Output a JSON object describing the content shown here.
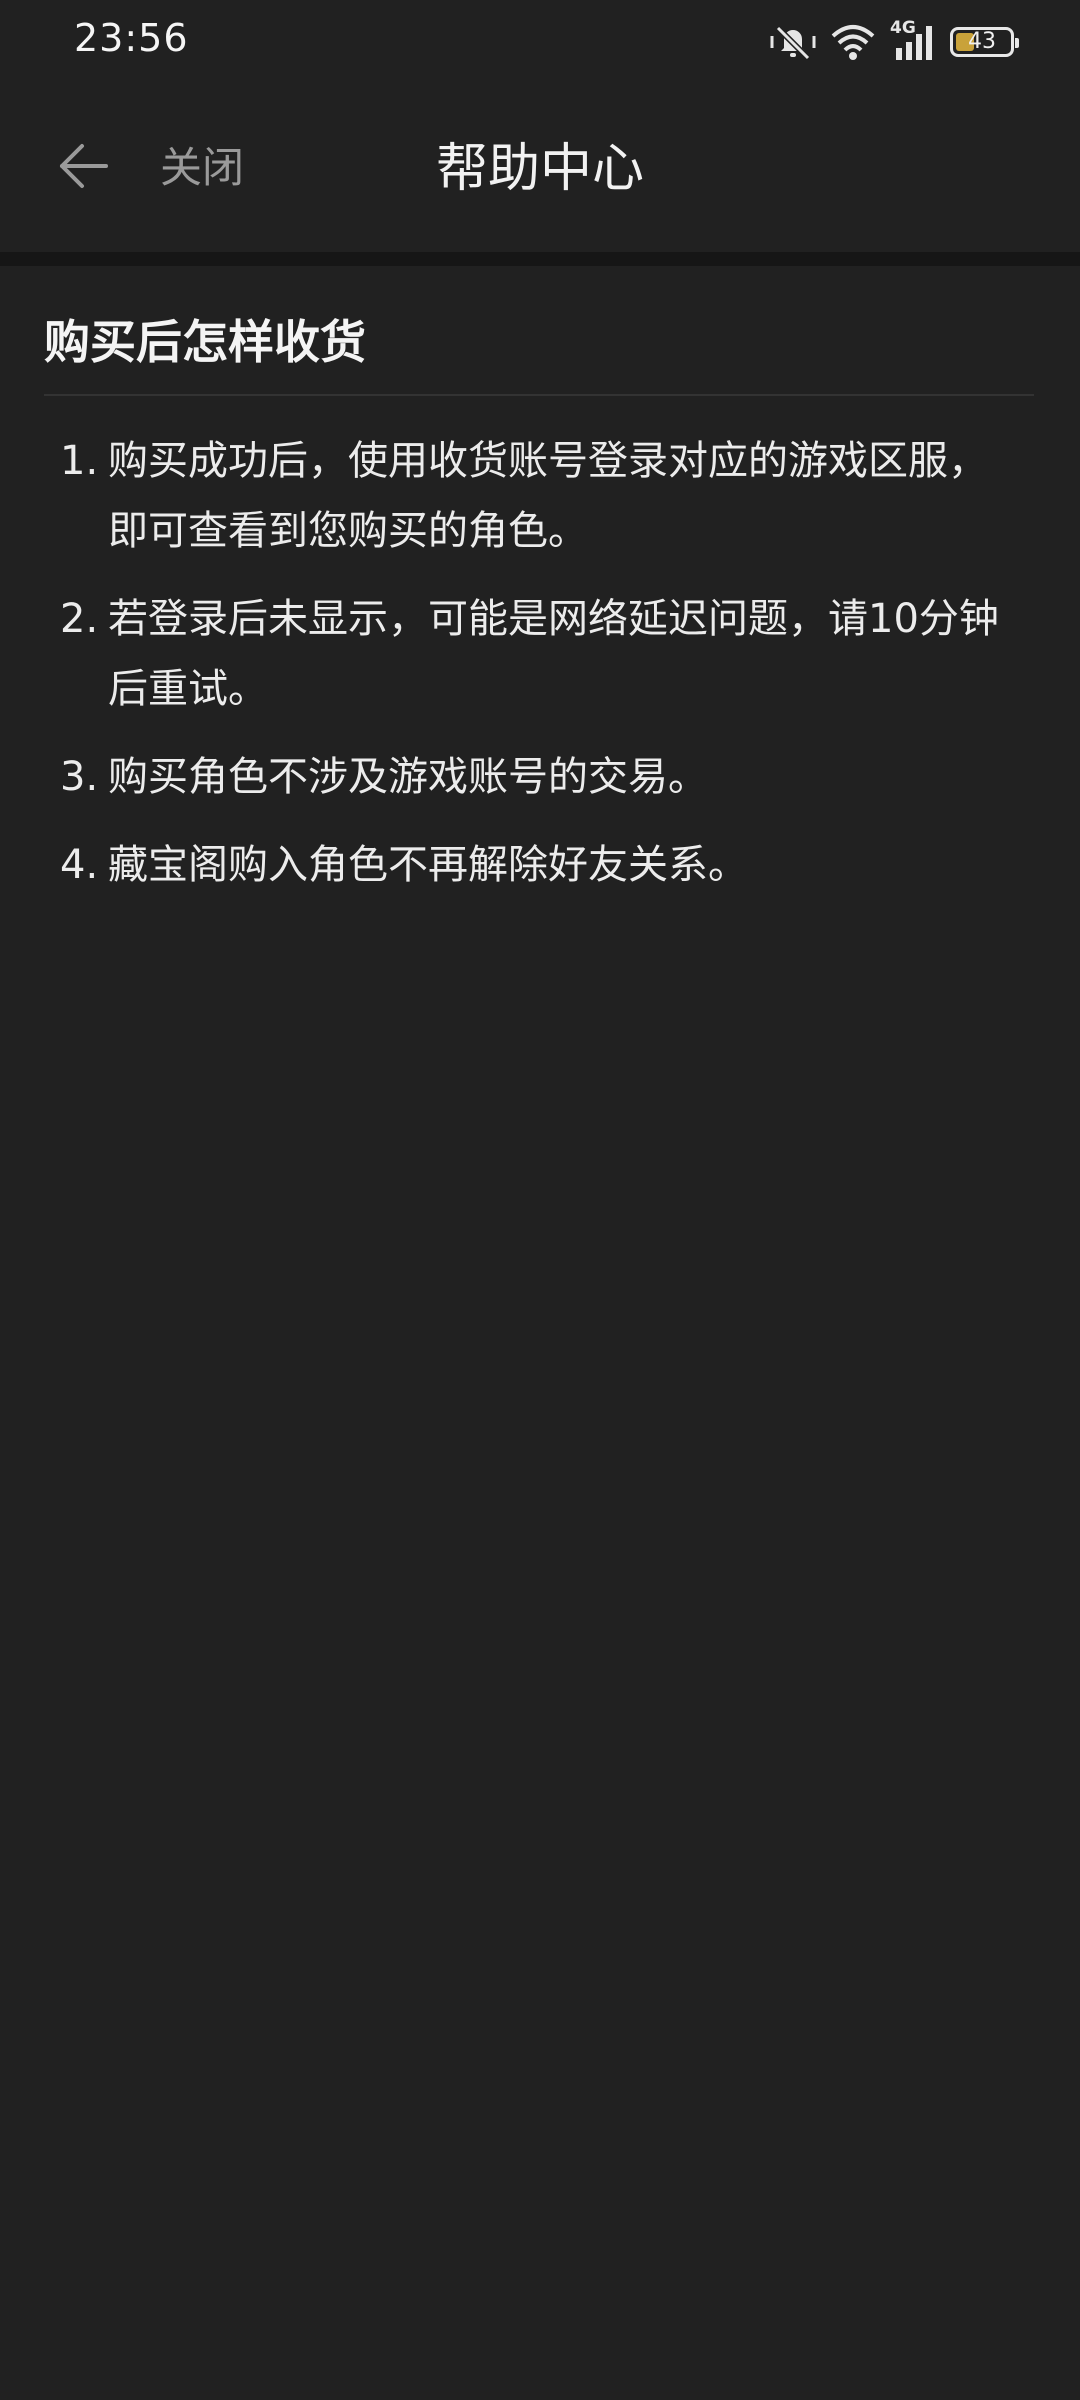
{
  "status_bar": {
    "time": "23:56",
    "network": "4G",
    "battery": "43",
    "icons": [
      "mute-vibrate-icon",
      "wifi-icon",
      "cellular-signal-icon",
      "battery-icon"
    ]
  },
  "nav": {
    "back_icon": "arrow-left-icon",
    "close_label": "关闭",
    "title": "帮助中心"
  },
  "article": {
    "title": "购买后怎样收货",
    "steps": [
      {
        "num": "1.",
        "text": "购买成功后，使用收货账号登录对应的游戏区服，即可查看到您购买的角色。"
      },
      {
        "num": "2.",
        "text": "若登录后未显示，可能是网络延迟问题，请10分钟后重试。"
      },
      {
        "num": "3.",
        "text": "购买角色不涉及游戏账号的交易。"
      },
      {
        "num": "4.",
        "text": "藏宝阁购入角色不再解除好友关系。"
      }
    ]
  },
  "colors": {
    "background": "#212121",
    "text": "#ececec",
    "muted": "#9a9a9a",
    "battery_fill": "#c9a23a"
  }
}
